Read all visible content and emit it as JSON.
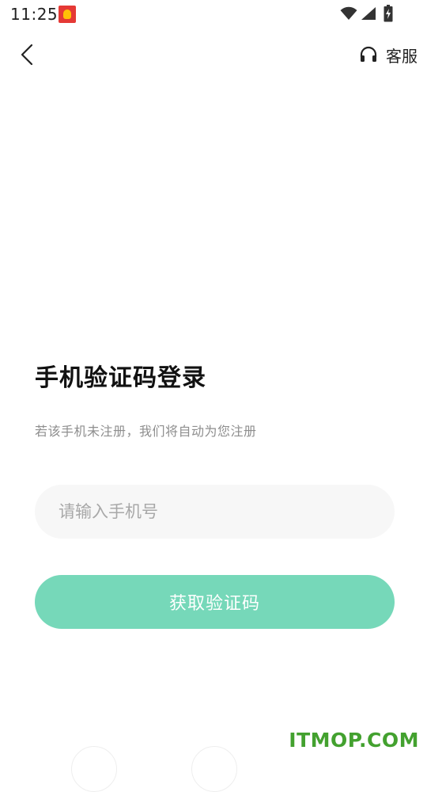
{
  "status_bar": {
    "time": "11:25",
    "icons": [
      "notification-icon",
      "wifi-icon",
      "signal-icon",
      "battery-charging-icon"
    ]
  },
  "header": {
    "back_icon": "chevron-left-icon",
    "support_icon": "headset-icon",
    "support_label": "客服"
  },
  "login": {
    "title": "手机验证码登录",
    "subtitle": "若该手机未注册，我们将自动为您注册",
    "phone_placeholder": "请输入手机号",
    "phone_value": "",
    "get_code_label": "获取验证码"
  },
  "watermark": "ITMOP.COM",
  "colors": {
    "accent": "#76d8b9",
    "input_bg": "#f7f7f7",
    "title": "#111111",
    "subtitle": "#8e8e8e",
    "placeholder": "#a8a8a8",
    "watermark": "#43a12f"
  }
}
